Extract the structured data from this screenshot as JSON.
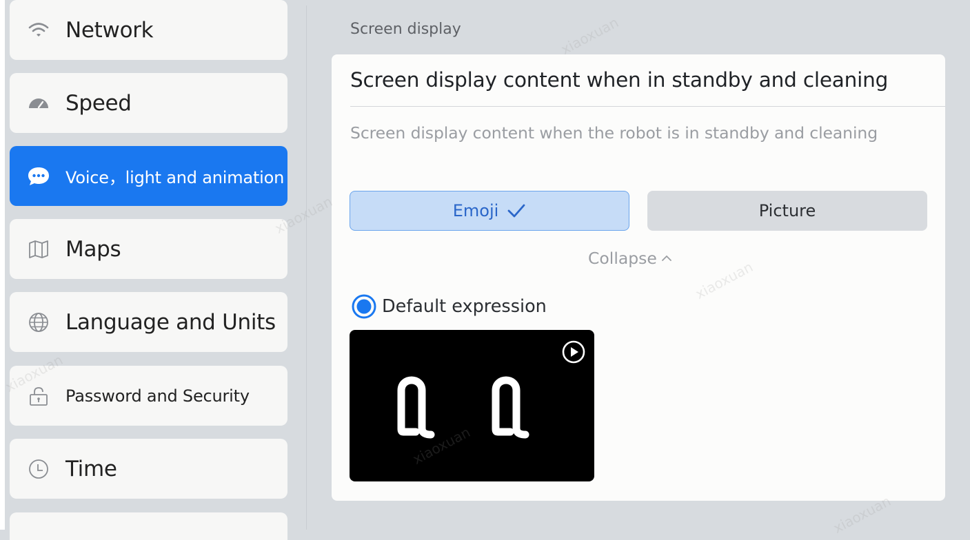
{
  "sidebar": {
    "items": [
      {
        "label": "Network",
        "icon": "wifi-icon"
      },
      {
        "label": "Speed",
        "icon": "speedometer-icon"
      },
      {
        "label": "Voice，light and animation",
        "icon": "chat-bubble-icon"
      },
      {
        "label": "Maps",
        "icon": "map-icon"
      },
      {
        "label": "Language and Units",
        "icon": "globe-icon"
      },
      {
        "label": "Password and Security",
        "icon": "lock-icon"
      },
      {
        "label": "Time",
        "icon": "clock-icon"
      }
    ],
    "active_index": 2
  },
  "main": {
    "section_title": "Screen display",
    "card": {
      "heading": "Screen display content when in standby and cleaning",
      "description": "Screen display content when the robot is in standby and cleaning",
      "options": [
        {
          "label": "Emoji",
          "selected": true
        },
        {
          "label": "Picture",
          "selected": false
        }
      ],
      "collapse_label": "Collapse",
      "expression": {
        "label": "Default expression",
        "selected": true
      }
    }
  },
  "colors": {
    "accent": "#1a78f0",
    "background": "#d7dbdf",
    "card": "#fcfcfb",
    "selected_option_bg": "#c6dcf7"
  },
  "watermark_text": "xiaoxuan"
}
